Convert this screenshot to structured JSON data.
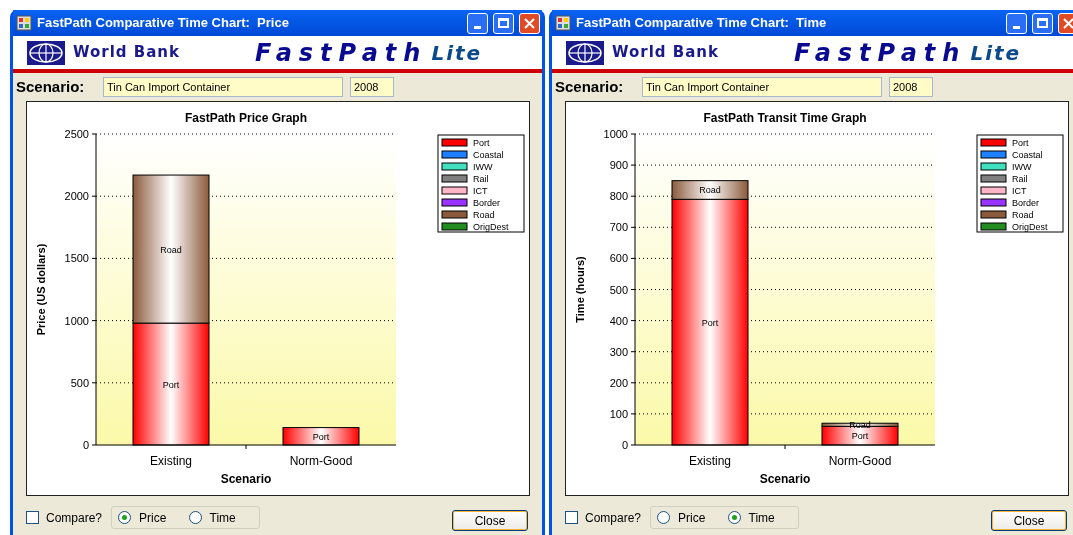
{
  "windows": [
    {
      "title": "FastPath Comparative Time Chart:  Price",
      "banner": {
        "org": "World Bank",
        "product": "FastPath",
        "edition": "Lite"
      },
      "scenario": {
        "label": "Scenario:",
        "name": "Tin Can Import Container",
        "year": "2008"
      },
      "chart_data": {
        "type": "bar",
        "stacked": true,
        "grid": true,
        "legend": true,
        "title": "FastPath Price Graph",
        "xlabel": "Scenario",
        "ylabel": "Price (US dollars)",
        "categories": [
          "Existing",
          "Norm-Good"
        ],
        "ylim": [
          0,
          2500
        ],
        "yticks": [
          0,
          500,
          1000,
          1500,
          2000,
          2500
        ],
        "series": [
          {
            "name": "Port",
            "color": "#ff0000",
            "values": [
              980,
              140
            ]
          },
          {
            "name": "Coastal",
            "color": "#1e7fff",
            "values": [
              0,
              0
            ]
          },
          {
            "name": "IWW",
            "color": "#40e0c0",
            "values": [
              0,
              0
            ]
          },
          {
            "name": "Rail",
            "color": "#808080",
            "values": [
              0,
              0
            ]
          },
          {
            "name": "ICT",
            "color": "#ffb6c8",
            "values": [
              0,
              0
            ]
          },
          {
            "name": "Border",
            "color": "#9933ff",
            "values": [
              0,
              0
            ]
          },
          {
            "name": "Road",
            "color": "#8b5a3c",
            "values": [
              1190,
              0
            ]
          },
          {
            "name": "OrigDest",
            "color": "#228b22",
            "values": [
              0,
              0
            ]
          }
        ]
      },
      "compare": {
        "label": "Compare?",
        "checked": false
      },
      "options": [
        {
          "label": "Price",
          "selected": true
        },
        {
          "label": "Time",
          "selected": false
        }
      ],
      "close_button": "Close"
    },
    {
      "title": "FastPath Comparative Time Chart:  Time",
      "banner": {
        "org": "World Bank",
        "product": "FastPath",
        "edition": "Lite"
      },
      "scenario": {
        "label": "Scenario:",
        "name": "Tin Can Import Container",
        "year": "2008"
      },
      "chart_data": {
        "type": "bar",
        "stacked": true,
        "grid": true,
        "legend": true,
        "title": "FastPath Transit Time Graph",
        "xlabel": "Scenario",
        "ylabel": "Time (hours)",
        "categories": [
          "Existing",
          "Norm-Good"
        ],
        "ylim": [
          0,
          1000
        ],
        "yticks": [
          0,
          100,
          200,
          300,
          400,
          500,
          600,
          700,
          800,
          900,
          1000
        ],
        "series": [
          {
            "name": "Port",
            "color": "#ff0000",
            "values": [
              790,
              60
            ]
          },
          {
            "name": "Coastal",
            "color": "#1e7fff",
            "values": [
              0,
              0
            ]
          },
          {
            "name": "IWW",
            "color": "#40e0c0",
            "values": [
              0,
              0
            ]
          },
          {
            "name": "Rail",
            "color": "#808080",
            "values": [
              0,
              0
            ]
          },
          {
            "name": "ICT",
            "color": "#ffb6c8",
            "values": [
              0,
              0
            ]
          },
          {
            "name": "Border",
            "color": "#9933ff",
            "values": [
              0,
              0
            ]
          },
          {
            "name": "Road",
            "color": "#8b5a3c",
            "values": [
              60,
              10
            ]
          },
          {
            "name": "OrigDest",
            "color": "#228b22",
            "values": [
              0,
              0
            ]
          }
        ]
      },
      "compare": {
        "label": "Compare?",
        "checked": false
      },
      "options": [
        {
          "label": "Price",
          "selected": false
        },
        {
          "label": "Time",
          "selected": true
        }
      ],
      "close_button": "Close"
    }
  ]
}
